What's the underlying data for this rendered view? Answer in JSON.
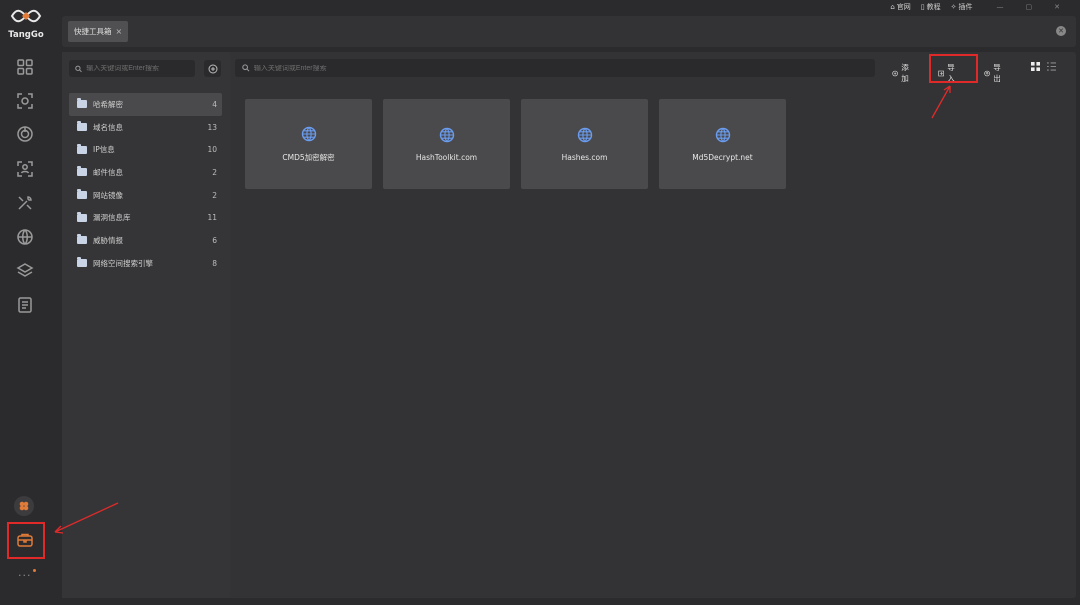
{
  "app": {
    "logo_text": "TangGo"
  },
  "top_links": {
    "website": "官网",
    "tutorial": "教程",
    "plugin": "插件"
  },
  "tab": {
    "label": "快捷工具箱"
  },
  "sidebar": {
    "search_placeholder": "输入关键词或Enter搜索",
    "categories": [
      {
        "label": "哈希解密",
        "count": "4",
        "active": true
      },
      {
        "label": "域名信息",
        "count": "13"
      },
      {
        "label": "IP信息",
        "count": "10"
      },
      {
        "label": "邮件信息",
        "count": "2"
      },
      {
        "label": "网站镜像",
        "count": "2"
      },
      {
        "label": "漏洞信息库",
        "count": "11"
      },
      {
        "label": "威胁情报",
        "count": "6"
      },
      {
        "label": "网络空间搜索引擎",
        "count": "8"
      }
    ]
  },
  "main": {
    "search_placeholder": "输入关键词或Enter搜索",
    "actions": {
      "add": "添加",
      "import": "导入",
      "export": "导出"
    },
    "cards": [
      {
        "label": "CMD5加密解密"
      },
      {
        "label": "HashToolkit.com"
      },
      {
        "label": "Hashes.com"
      },
      {
        "label": "Md5Decrypt.net"
      }
    ]
  },
  "colors": {
    "highlight_red": "#e02a2a",
    "globe_blue": "#6a9cf0"
  },
  "icons": [
    "dashboard-icon",
    "scan-icon",
    "target-icon",
    "person-scan-icon",
    "tools-icon",
    "globe-grid-icon",
    "layers-icon",
    "notes-icon",
    "plugin-icon",
    "toolbox-icon"
  ]
}
